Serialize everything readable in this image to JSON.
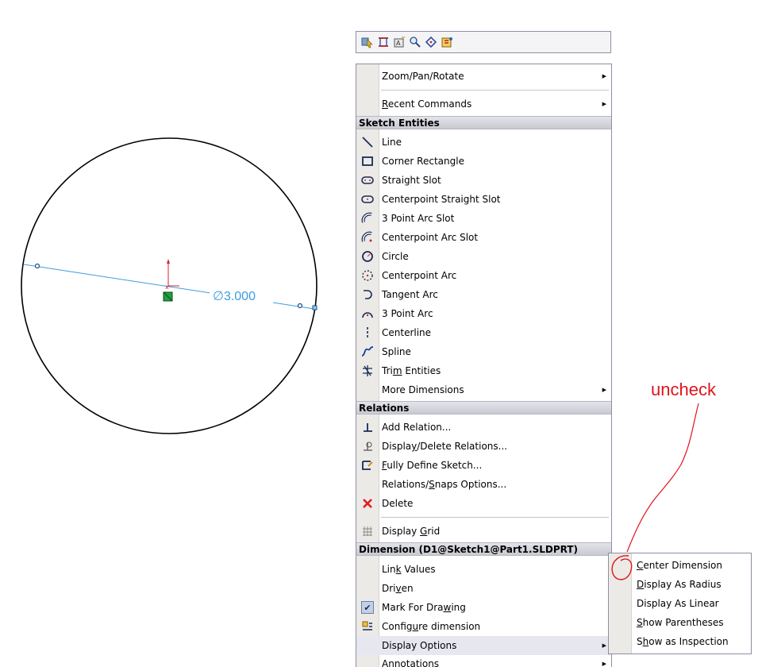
{
  "dimension": {
    "label": "∅3.000"
  },
  "annotation": {
    "text": "uncheck"
  },
  "colors": {
    "menu_header": "#cdcdd6",
    "dimension_blue": "#3e9be0",
    "annotation_red": "#e0141c"
  },
  "menu": {
    "zoom": "Zoom/Pan/Rotate",
    "recent": "Recent Commands",
    "sketch_header": "Sketch Entities",
    "sketch_items": [
      {
        "label": "Line",
        "icon": "line-icon"
      },
      {
        "label": "Corner Rectangle",
        "icon": "rectangle-icon"
      },
      {
        "label": "Straight Slot",
        "icon": "straight-slot-icon"
      },
      {
        "label": "Centerpoint Straight Slot",
        "icon": "centerpoint-slot-icon"
      },
      {
        "label": "3 Point Arc Slot",
        "icon": "arc-slot-icon"
      },
      {
        "label": "Centerpoint Arc Slot",
        "icon": "centerpoint-arc-slot-icon"
      },
      {
        "label": "Circle",
        "icon": "circle-icon"
      },
      {
        "label": "Centerpoint Arc",
        "icon": "centerpoint-arc-icon"
      },
      {
        "label": "Tangent Arc",
        "icon": "tangent-arc-icon"
      },
      {
        "label": "3 Point Arc",
        "icon": "three-point-arc-icon"
      },
      {
        "label": "Centerline",
        "icon": "centerline-icon"
      },
      {
        "label": "Spline",
        "icon": "spline-icon"
      },
      {
        "label": "Trim Entities",
        "icon": "trim-icon"
      },
      {
        "label": "More Dimensions",
        "icon": ""
      }
    ],
    "relations_header": "Relations",
    "relations_items": [
      {
        "label": "Add Relation...",
        "icon": "add-relation-icon"
      },
      {
        "label": "Display/Delete Relations...",
        "icon": "display-relations-icon"
      },
      {
        "label": "Fully Define Sketch...",
        "icon": "fully-define-icon"
      },
      {
        "label": "Relations/Snaps Options...",
        "icon": ""
      },
      {
        "label": "Delete",
        "icon": "delete-icon"
      }
    ],
    "grid": "Display Grid",
    "dimension_header": "Dimension (D1@Sketch1@Part1.SLDPRT)",
    "dimension_items": [
      {
        "label": "Link Values"
      },
      {
        "label": "Driven"
      },
      {
        "label": "Mark For Drawing"
      },
      {
        "label": "Configure dimension"
      },
      {
        "label": "Display Options"
      },
      {
        "label": "Annotations"
      }
    ]
  },
  "submenu": {
    "items": [
      "Center Dimension",
      "Display As Radius",
      "Display As Linear",
      "Show Parentheses",
      "Show as Inspection"
    ]
  }
}
